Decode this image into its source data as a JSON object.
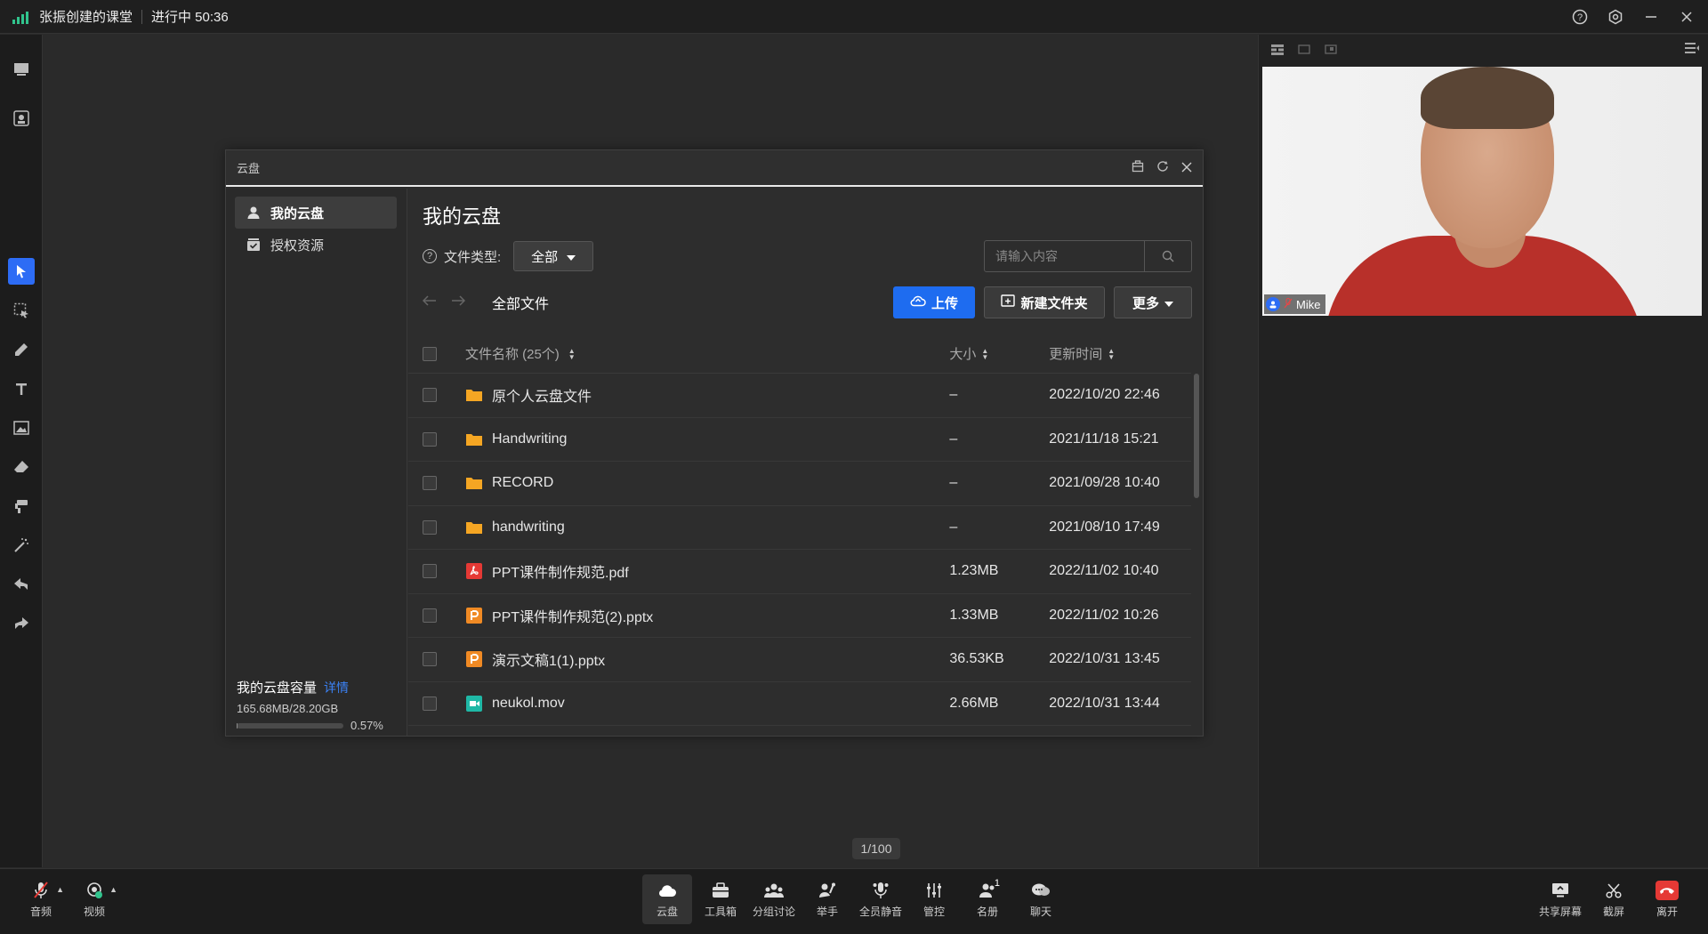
{
  "titlebar": {
    "title": "张振创建的课堂",
    "status": "进行中 50:36",
    "icons": [
      "help-icon",
      "settings-icon",
      "minimize-icon",
      "close-icon"
    ]
  },
  "left_toolbar": {
    "tools": [
      "chat-window-icon",
      "camera-frame-icon",
      "pointer-icon",
      "select-icon",
      "pen-icon",
      "text-icon",
      "image-icon",
      "eraser-icon",
      "paint-icon",
      "magic-wand-icon",
      "undo-icon",
      "redo-icon"
    ],
    "active": "pointer-icon"
  },
  "canvas": {
    "page_indicator": "1/100"
  },
  "video": {
    "participant_name": "Mike"
  },
  "dialog": {
    "title": "云盘",
    "sidebar": {
      "items": [
        {
          "label": "我的云盘",
          "icon": "user-icon",
          "active": true
        },
        {
          "label": "授权资源",
          "icon": "authorized-box-icon",
          "active": false
        }
      ],
      "capacity_label": "我的云盘容量",
      "capacity_link": "详情",
      "capacity_size": "165.68MB/28.20GB",
      "capacity_percent": "0.57%",
      "capacity_fraction": 0.0057
    },
    "main": {
      "title": "我的云盘",
      "filter_label": "文件类型:",
      "filter_value": "全部",
      "search_placeholder": "请输入内容",
      "breadcrumb": "全部文件",
      "buttons": {
        "upload": "上传",
        "new_folder": "新建文件夹",
        "more": "更多"
      },
      "columns": {
        "name": "文件名称 (25个)",
        "size": "大小",
        "time": "更新时间"
      },
      "rows": [
        {
          "name": "原个人云盘文件",
          "size": "–",
          "time": "2022/10/20 22:46",
          "type": "folder"
        },
        {
          "name": "Handwriting",
          "size": "–",
          "time": "2021/11/18 15:21",
          "type": "folder"
        },
        {
          "name": "RECORD",
          "size": "–",
          "time": "2021/09/28 10:40",
          "type": "folder"
        },
        {
          "name": "handwriting",
          "size": "–",
          "time": "2021/08/10 17:49",
          "type": "folder"
        },
        {
          "name": "PPT课件制作规范.pdf",
          "size": "1.23MB",
          "time": "2022/11/02 10:40",
          "type": "pdf"
        },
        {
          "name": "PPT课件制作规范(2).pptx",
          "size": "1.33MB",
          "time": "2022/11/02 10:26",
          "type": "pptx"
        },
        {
          "name": "演示文稿1(1).pptx",
          "size": "36.53KB",
          "time": "2022/10/31 13:45",
          "type": "pptx"
        },
        {
          "name": "neukol.mov",
          "size": "2.66MB",
          "time": "2022/10/31 13:44",
          "type": "video"
        }
      ]
    }
  },
  "bottombar": {
    "audio": "音频",
    "video": "视频",
    "cloud": "云盘",
    "toolbox": "工具箱",
    "group": "分组讨论",
    "raise_hand": "举手",
    "mute_all": "全员静音",
    "control": "管控",
    "roster": "名册",
    "roster_badge": "1",
    "chat": "聊天",
    "share": "共享屏幕",
    "screenshot": "截屏",
    "leave": "离开"
  }
}
